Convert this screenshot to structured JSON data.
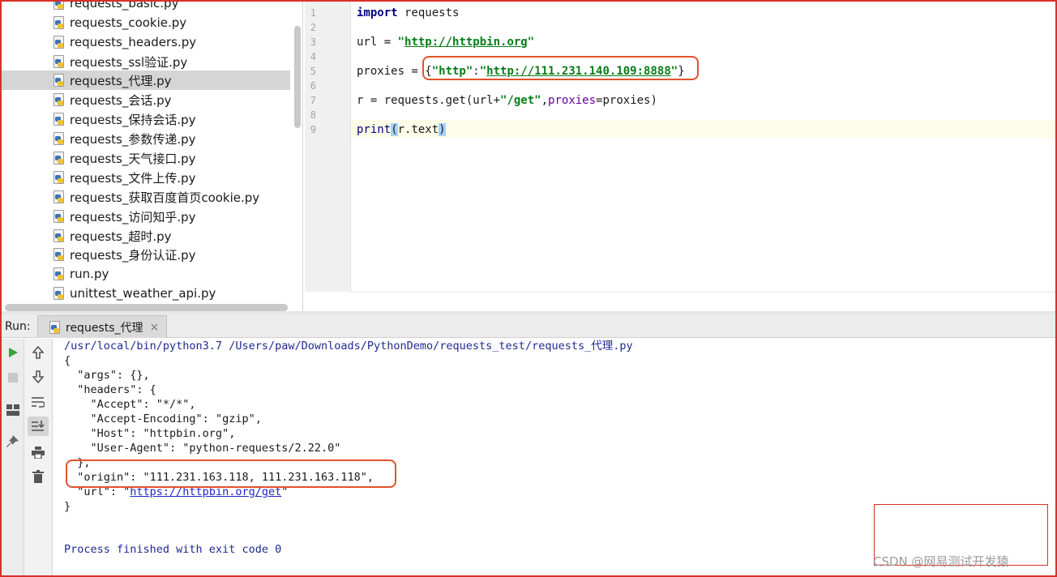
{
  "project_tree": {
    "items": [
      {
        "label": "requests_basic.py",
        "selected": false
      },
      {
        "label": "requests_cookie.py",
        "selected": false
      },
      {
        "label": "requests_headers.py",
        "selected": false
      },
      {
        "label": "requests_ssl验证.py",
        "selected": false
      },
      {
        "label": "requests_代理.py",
        "selected": true
      },
      {
        "label": "requests_会话.py",
        "selected": false
      },
      {
        "label": "requests_保持会话.py",
        "selected": false
      },
      {
        "label": "requests_参数传递.py",
        "selected": false
      },
      {
        "label": "requests_天气接口.py",
        "selected": false
      },
      {
        "label": "requests_文件上传.py",
        "selected": false
      },
      {
        "label": "requests_获取百度首页cookie.py",
        "selected": false
      },
      {
        "label": "requests_访问知乎.py",
        "selected": false
      },
      {
        "label": "requests_超时.py",
        "selected": false
      },
      {
        "label": "requests_身份认证.py",
        "selected": false
      },
      {
        "label": "run.py",
        "selected": false
      },
      {
        "label": "unittest_weather_api.py",
        "selected": false
      }
    ]
  },
  "editor": {
    "line_numbers": [
      "1",
      "2",
      "3",
      "4",
      "5",
      "6",
      "7",
      "8",
      "9"
    ],
    "code": {
      "l1_kw": "import",
      "l1_rest": " requests",
      "l3_a": "url = ",
      "l3_q1": "\"",
      "l3_url": "http://httpbin.org",
      "l3_q2": "\"",
      "l5_a": "proxies = {",
      "l5_key": "\"http\"",
      "l5_colon": ":",
      "l5_q1": "\"",
      "l5_url": "http://111.231.140.109:8888",
      "l5_q2": "\"",
      "l5_end": "}",
      "l7_a": "r = requests.get(url+",
      "l7_str": "\"/get\"",
      "l7_b": ",",
      "l7_param": "proxies",
      "l7_c": "=proxies)",
      "l9_fn": "print",
      "l9_open": "(",
      "l9_mid": "r.text",
      "l9_close": ")"
    }
  },
  "run_panel": {
    "label": "Run:",
    "tab_label": "requests_代理",
    "tab_close": "×",
    "console": {
      "command": "/usr/local/bin/python3.7 /Users/paw/Downloads/PythonDemo/requests_test/requests_代理.py",
      "lines": [
        "{",
        "  \"args\": {},",
        "  \"headers\": {",
        "    \"Accept\": \"*/*\",",
        "    \"Accept-Encoding\": \"gzip\",",
        "    \"Host\": \"httpbin.org\",",
        "    \"User-Agent\": \"python-requests/2.22.0\"",
        "  },",
        "  \"origin\": \"111.231.163.118, 111.231.163.118\","
      ],
      "url_prefix": "  \"url\": \"",
      "url_link": "https://httpbin.org/get",
      "url_suffix": "\"",
      "close_brace": "}",
      "finish": "Process finished with exit code 0"
    }
  },
  "watermark": "CSDN @网易测试开发猿",
  "colors": {
    "annotation": "#e2522b",
    "selection": "#d5d5d5",
    "string": "#067d17",
    "keyword": "#000080"
  }
}
